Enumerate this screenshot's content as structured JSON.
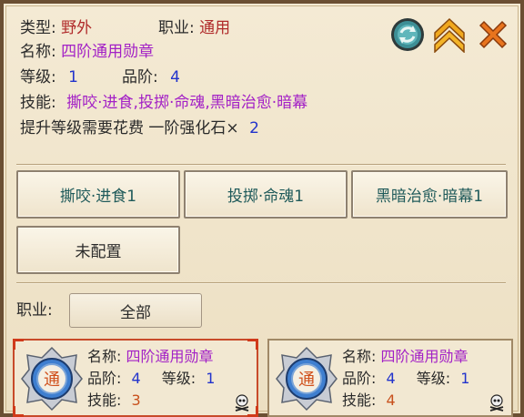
{
  "detail": {
    "type_label": "类型:",
    "type_value": "野外",
    "job_label": "职业:",
    "job_value": "通用",
    "name_label": "名称:",
    "name_value": "四阶通用勋章",
    "level_label": "等级:",
    "level_value": "1",
    "grade_label": "品阶:",
    "grade_value": "4",
    "skill_label": "技能:",
    "skill_value": "撕咬·进食,投掷·命魂,黑暗治愈·暗幕",
    "upgrade_text": "提升等级需要花费 一阶强化石×",
    "upgrade_count": "2"
  },
  "actions": {
    "refresh_icon": "refresh-icon",
    "upgrade_icon": "upgrade-chevron-icon",
    "close_icon": "close-icon"
  },
  "skills": [
    {
      "label": "撕咬·进食1"
    },
    {
      "label": "投掷·命魂1"
    },
    {
      "label": "黑暗治愈·暗幕1"
    },
    {
      "label": "未配置"
    }
  ],
  "filter": {
    "label": "职业:",
    "value": "全部"
  },
  "cards": [
    {
      "name_label": "名称:",
      "name": "四阶通用勋章",
      "grade_label": "品阶:",
      "grade": "4",
      "level_label": "等级:",
      "level": "1",
      "skill_label": "技能:",
      "skill": "3",
      "badge_char": "通"
    },
    {
      "name_label": "名称:",
      "name": "四阶通用勋章",
      "grade_label": "品阶:",
      "grade": "4",
      "level_label": "等级:",
      "level": "1",
      "skill_label": "技能:",
      "skill": "4",
      "badge_char": "通"
    }
  ],
  "colors": {
    "frame": "#6b4f33",
    "panel": "#ede1c6",
    "value_red": "#b02a2a",
    "value_purple": "#a321c6",
    "value_blue": "#2233cc",
    "value_orange": "#c8501c",
    "close_orange": "#e8741e"
  }
}
